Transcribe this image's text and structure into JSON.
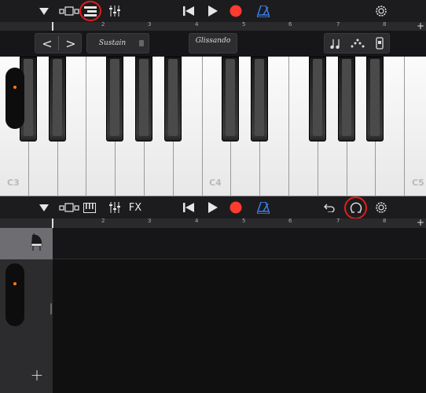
{
  "top_toolbar": {
    "icons": [
      "dropdown-triangle-icon",
      "view-toggle-icon",
      "track-list-icon",
      "mixer-sliders-icon",
      "rewind-icon",
      "play-icon",
      "record-icon",
      "metronome-icon",
      "settings-gear-icon"
    ]
  },
  "top_ruler": {
    "numbers": [
      "2",
      "3",
      "4",
      "5",
      "6",
      "7",
      "8"
    ]
  },
  "keyboard_controls": {
    "sustain_label": "Sustain",
    "glissando_label": "Glissando",
    "prev_octave": "<",
    "next_octave": ">"
  },
  "keyboard": {
    "labels": {
      "c3": "C3",
      "c4": "C4",
      "c5": "C5"
    }
  },
  "bottom_toolbar": {
    "fx_label": "FX",
    "icons": [
      "dropdown-triangle-icon",
      "view-toggle-icon",
      "keyboard-icon",
      "mixer-sliders-icon",
      "rewind-icon",
      "play-icon",
      "record-icon",
      "metronome-icon",
      "undo-icon",
      "loop-browser-icon",
      "settings-gear-icon"
    ]
  },
  "bottom_ruler": {
    "numbers": [
      "2",
      "3",
      "4",
      "5",
      "6",
      "7",
      "8"
    ]
  },
  "track_panel": {
    "add_track_label": "+",
    "track_icon": "grand-piano-icon"
  },
  "colors": {
    "record": "#ff3b30",
    "highlight_circle": "#e11d1d",
    "metronome_blue": "#3b82f6",
    "toolbar_bg": "#1c1c1e"
  }
}
